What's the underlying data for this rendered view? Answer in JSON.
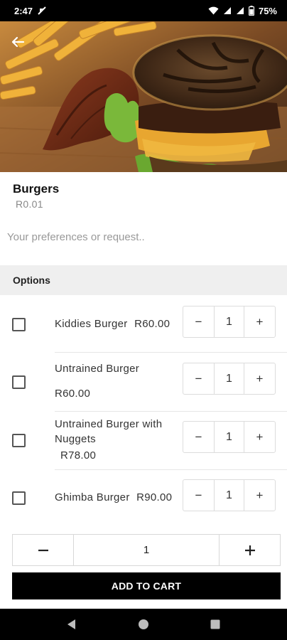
{
  "status_bar": {
    "time": "2:47",
    "battery": "75%"
  },
  "colors": {
    "primary": "#000000",
    "header_bg": "#efefef",
    "divider": "#e6e6e6"
  },
  "product": {
    "title": "Burgers",
    "price": "R0.01"
  },
  "preferences": {
    "placeholder": "Your preferences or request.."
  },
  "options": {
    "header": "Options",
    "items": [
      {
        "label_line1": "Kiddies Burger",
        "price": "R60.00",
        "quantity": "1",
        "checked": false
      },
      {
        "label_line1": "Untrained Burger",
        "price": "R60.00",
        "quantity": "1",
        "checked": false
      },
      {
        "label_line1": "Untrained Burger with",
        "label_line2": "Nuggets",
        "price": "R78.00",
        "quantity": "1",
        "checked": false
      },
      {
        "label_line1": "Ghimba Burger",
        "price": "R90.00",
        "quantity": "1",
        "checked": false
      }
    ]
  },
  "stepper": {
    "minus": "−",
    "plus": "+"
  },
  "cart": {
    "quantity": "1",
    "add_label": "ADD TO CART"
  },
  "icons": {
    "back": "back-arrow-icon",
    "checkbox": "checkbox-icon",
    "minus": "minus-icon",
    "plus": "plus-icon",
    "nav_back": "nav-back-icon",
    "nav_home": "nav-home-icon",
    "nav_recents": "nav-recents-icon"
  }
}
